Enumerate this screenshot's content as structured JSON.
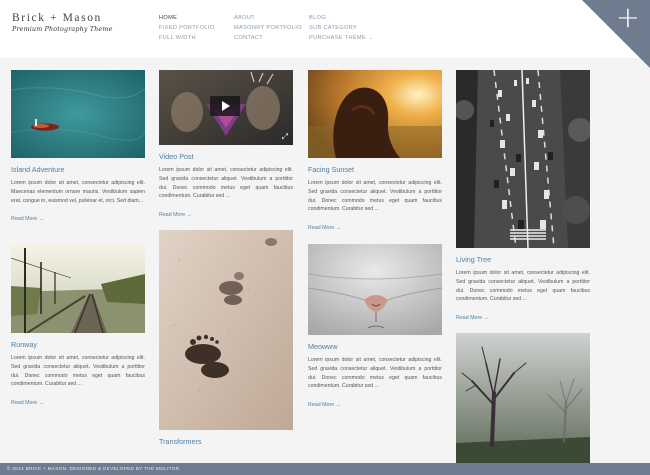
{
  "site": {
    "title": "Brick + Mason",
    "tagline": "Premium Photography Theme"
  },
  "nav": {
    "col1": [
      "HOME",
      "FIXED PORTFOLIO",
      "FULL WIDTH"
    ],
    "col2": [
      "ABOUT",
      "MASONRY PORTFOLIO",
      "CONTACT"
    ],
    "col3": [
      "BLOG",
      "SUB CATEGORY",
      "PURCHASE THEME →"
    ],
    "active": "HOME"
  },
  "corner_button": "+",
  "read_more": "Read More →",
  "posts": [
    {
      "title": "Island Adventure",
      "excerpt": "Lorem ipsum dolor sit amet, consectetur adipiscing elit. Maecenas elementum ornare mauris. Vestibulum sapien erat, congue in, euismod vel, pulvinar et, orci. Sed diam..."
    },
    {
      "title": "Video Post",
      "excerpt": "Lorem ipsum dolor sit amet, consectetur adipiscing elit. Sed gravida consectetur aliquet. Vestibulum a porttitor dui. Donec commodo metus eget quam faucibus condimentum. Curabitur sed ..."
    },
    {
      "title": "Facing Sunset",
      "excerpt": "Lorem ipsum dolor sit amet, consectetur adipiscing elit. Sed gravida consectetur aliquet. Vestibulum a porttitor dui. Donec commodo metus eget quam faucibus condimentum. Curabitur sed ..."
    },
    {
      "title": "Living Tree",
      "excerpt": "Lorem ipsum dolor sit amet, consectetur adipiscing elit. Sed gravida consectetur aliquet. Vestibulum a porttitor dui. Donec commodo metus eget quam faucibus condimentum. Curabitur sed ..."
    },
    {
      "title": "Runway",
      "excerpt": "Lorem ipsum dolor sit amet, consectetur adipiscing elit. Sed gravida consectetur aliquet. Vestibulum a porttitor dui. Donec commodo metus eget quam faucibus condimentum. Curabitur sed ..."
    },
    {
      "title": "Transformers",
      "excerpt": ""
    },
    {
      "title": "Meowww",
      "excerpt": "Lorem ipsum dolor sit amet, consectetur adipiscing elit. Sed gravida consectetur aliquet. Vestibulum a porttitor dui. Donec commodo metus eget quam faucibus condimentum. Curabitur sed ..."
    },
    {
      "title": "",
      "excerpt": ""
    }
  ],
  "footer": "© 2014 BRICK + MASON. DESIGNED & DEVELOPED BY THE MOLITOR"
}
